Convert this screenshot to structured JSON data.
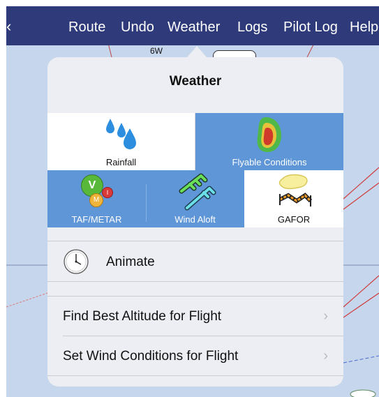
{
  "nav": {
    "items": [
      "Route",
      "Undo",
      "Weather",
      "Logs",
      "Pilot Log",
      "Help"
    ]
  },
  "map": {
    "grid_label": "6W"
  },
  "popover": {
    "title": "Weather",
    "layers": [
      {
        "label": "Rainfall",
        "selected": false,
        "icon": "raindrops-icon"
      },
      {
        "label": "Flyable Conditions",
        "selected": true,
        "icon": "flyable-conditions-icon"
      },
      {
        "label": "TAF/METAR",
        "selected": true,
        "icon": "taf-metar-icon"
      },
      {
        "label": "Wind Aloft",
        "selected": true,
        "icon": "wind-barb-icon"
      },
      {
        "label": "GAFOR",
        "selected": false,
        "icon": "gafor-icon"
      }
    ],
    "taf_badges": {
      "v": "V",
      "m": "M",
      "i": "I"
    },
    "animate_label": "Animate",
    "menu": [
      {
        "label": "Find Best Altitude for Flight"
      },
      {
        "label": "Set Wind Conditions for Flight"
      }
    ]
  },
  "colors": {
    "nav_bg": "#2e3a7a",
    "selected_cell": "#5e96d8",
    "popover_bg": "#eceef3"
  }
}
